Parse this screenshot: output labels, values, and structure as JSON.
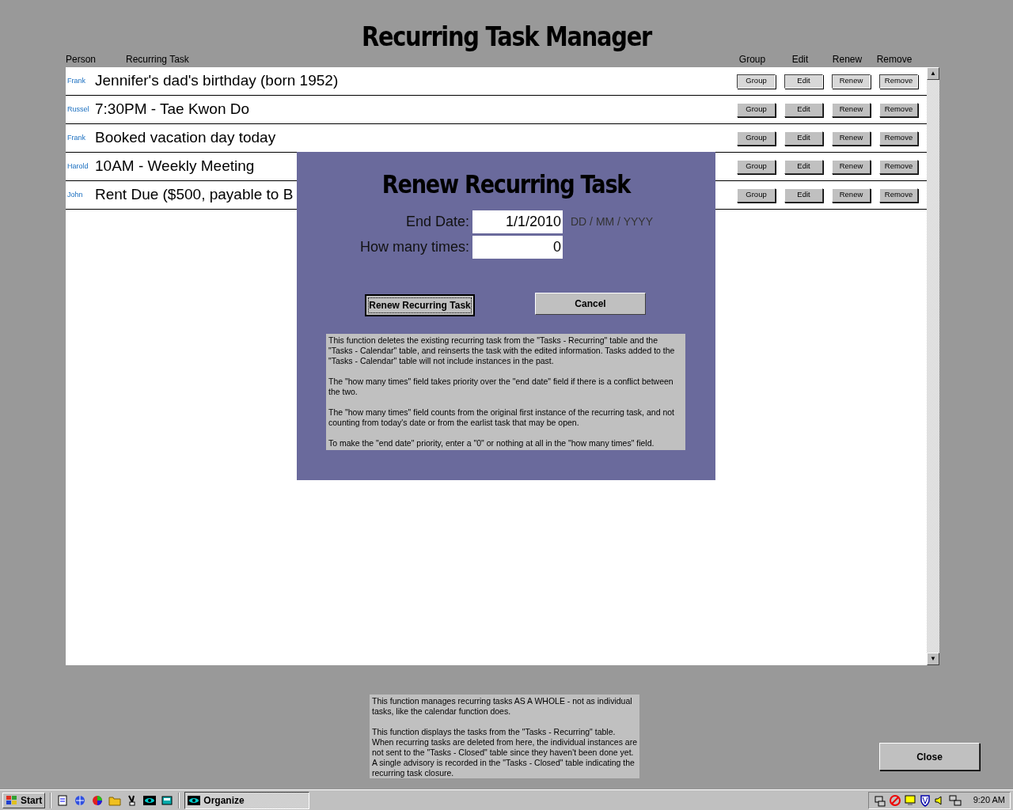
{
  "title": "Recurring Task Manager",
  "columns": [
    "Person",
    "Recurring Task",
    "Group",
    "Edit",
    "Renew",
    "Remove"
  ],
  "rows": [
    {
      "person": "Frank",
      "task": "Jennifer's dad's birthday (born 1952)",
      "selected": true,
      "buttons": [
        "Group",
        "Edit",
        "Renew",
        "Remove"
      ]
    },
    {
      "person": "Russel",
      "task": "7:30PM - Tae Kwon Do",
      "selected": false,
      "buttons": [
        "Group",
        "Edit",
        "Renew",
        "Remove"
      ]
    },
    {
      "person": "Frank",
      "task": "Booked vacation day today",
      "selected": false,
      "buttons": [
        "Group",
        "Edit",
        "Renew",
        "Remove"
      ]
    },
    {
      "person": "Harold",
      "task": "10AM - Weekly Meeting",
      "selected": false,
      "buttons": [
        "Group",
        "Edit",
        "Renew",
        "Remove"
      ]
    },
    {
      "person": "John",
      "task": "Rent Due ($500, payable to B",
      "selected": false,
      "buttons": [
        "Group",
        "Edit",
        "Renew",
        "Remove"
      ]
    }
  ],
  "scrollbar": {
    "up": "▲",
    "down": "▼"
  },
  "dialog": {
    "title": "Renew Recurring Task",
    "fields": [
      {
        "label": "End Date:",
        "value": "1/1/2010",
        "hint": "DD / MM / YYYY"
      },
      {
        "label": "How many times:",
        "value": "0"
      }
    ],
    "buttons": [
      {
        "label": "Renew Recurring Task",
        "focused": true
      },
      {
        "label": "Cancel",
        "focused": false
      }
    ],
    "notes": [
      "This function deletes the existing recurring task from the \"Tasks - Recurring\" table and the \"Tasks - Calendar\" table, and reinserts the task with the edited information.  Tasks added to the \"Tasks - Calendar\" table will not include instances in the past.",
      "The \"how many times\" field takes priority over the \"end date\" field if there is a conflict between the two.",
      "The \"how many times\" field counts from the original first instance of the recurring task, and not counting from today's date or from the earlist task that may be open.",
      "To make the \"end date\" priority, enter a \"0\" or nothing at all in the \"how many times\" field."
    ]
  },
  "notes": [
    "This function manages recurring tasks AS A WHOLE - not as individual tasks, like the calendar function does.",
    "This function displays the tasks from the \"Tasks - Recurring\" table. When recurring tasks are deleted from here, the individual instances are not sent to the \"Tasks - Closed\" table since they haven't been done yet.  A single advisory is recorded in the \"Tasks - Closed\" table indicating the recurring task closure."
  ],
  "close_button": "Close",
  "taskbar": {
    "start": "Start",
    "window": "Organize",
    "time": "9:20 AM"
  }
}
